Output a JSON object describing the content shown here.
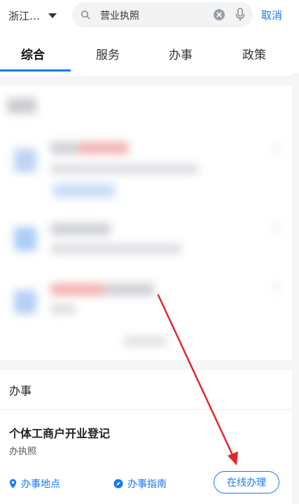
{
  "header": {
    "region_label": "浙江…",
    "search_value": "营业执照",
    "cancel_label": "取消"
  },
  "tabs": [
    {
      "label": "综合",
      "active": true
    },
    {
      "label": "服务",
      "active": false
    },
    {
      "label": "办事",
      "active": false
    },
    {
      "label": "政策",
      "active": false
    }
  ],
  "section": {
    "title": "办事",
    "item": {
      "title": "个体工商户开业登记",
      "subtitle": "办执照",
      "actions": {
        "location_label": "办事地点",
        "guide_label": "办事指南",
        "online_label": "在线办理"
      }
    }
  },
  "colors": {
    "accent": "#1677ff",
    "annotation_arrow": "#e0282e",
    "band": "#f5f6f8"
  },
  "icons": [
    "search-icon",
    "clear-icon",
    "microphone-icon",
    "chevron-right-icon",
    "location-pin-icon",
    "compass-icon"
  ]
}
